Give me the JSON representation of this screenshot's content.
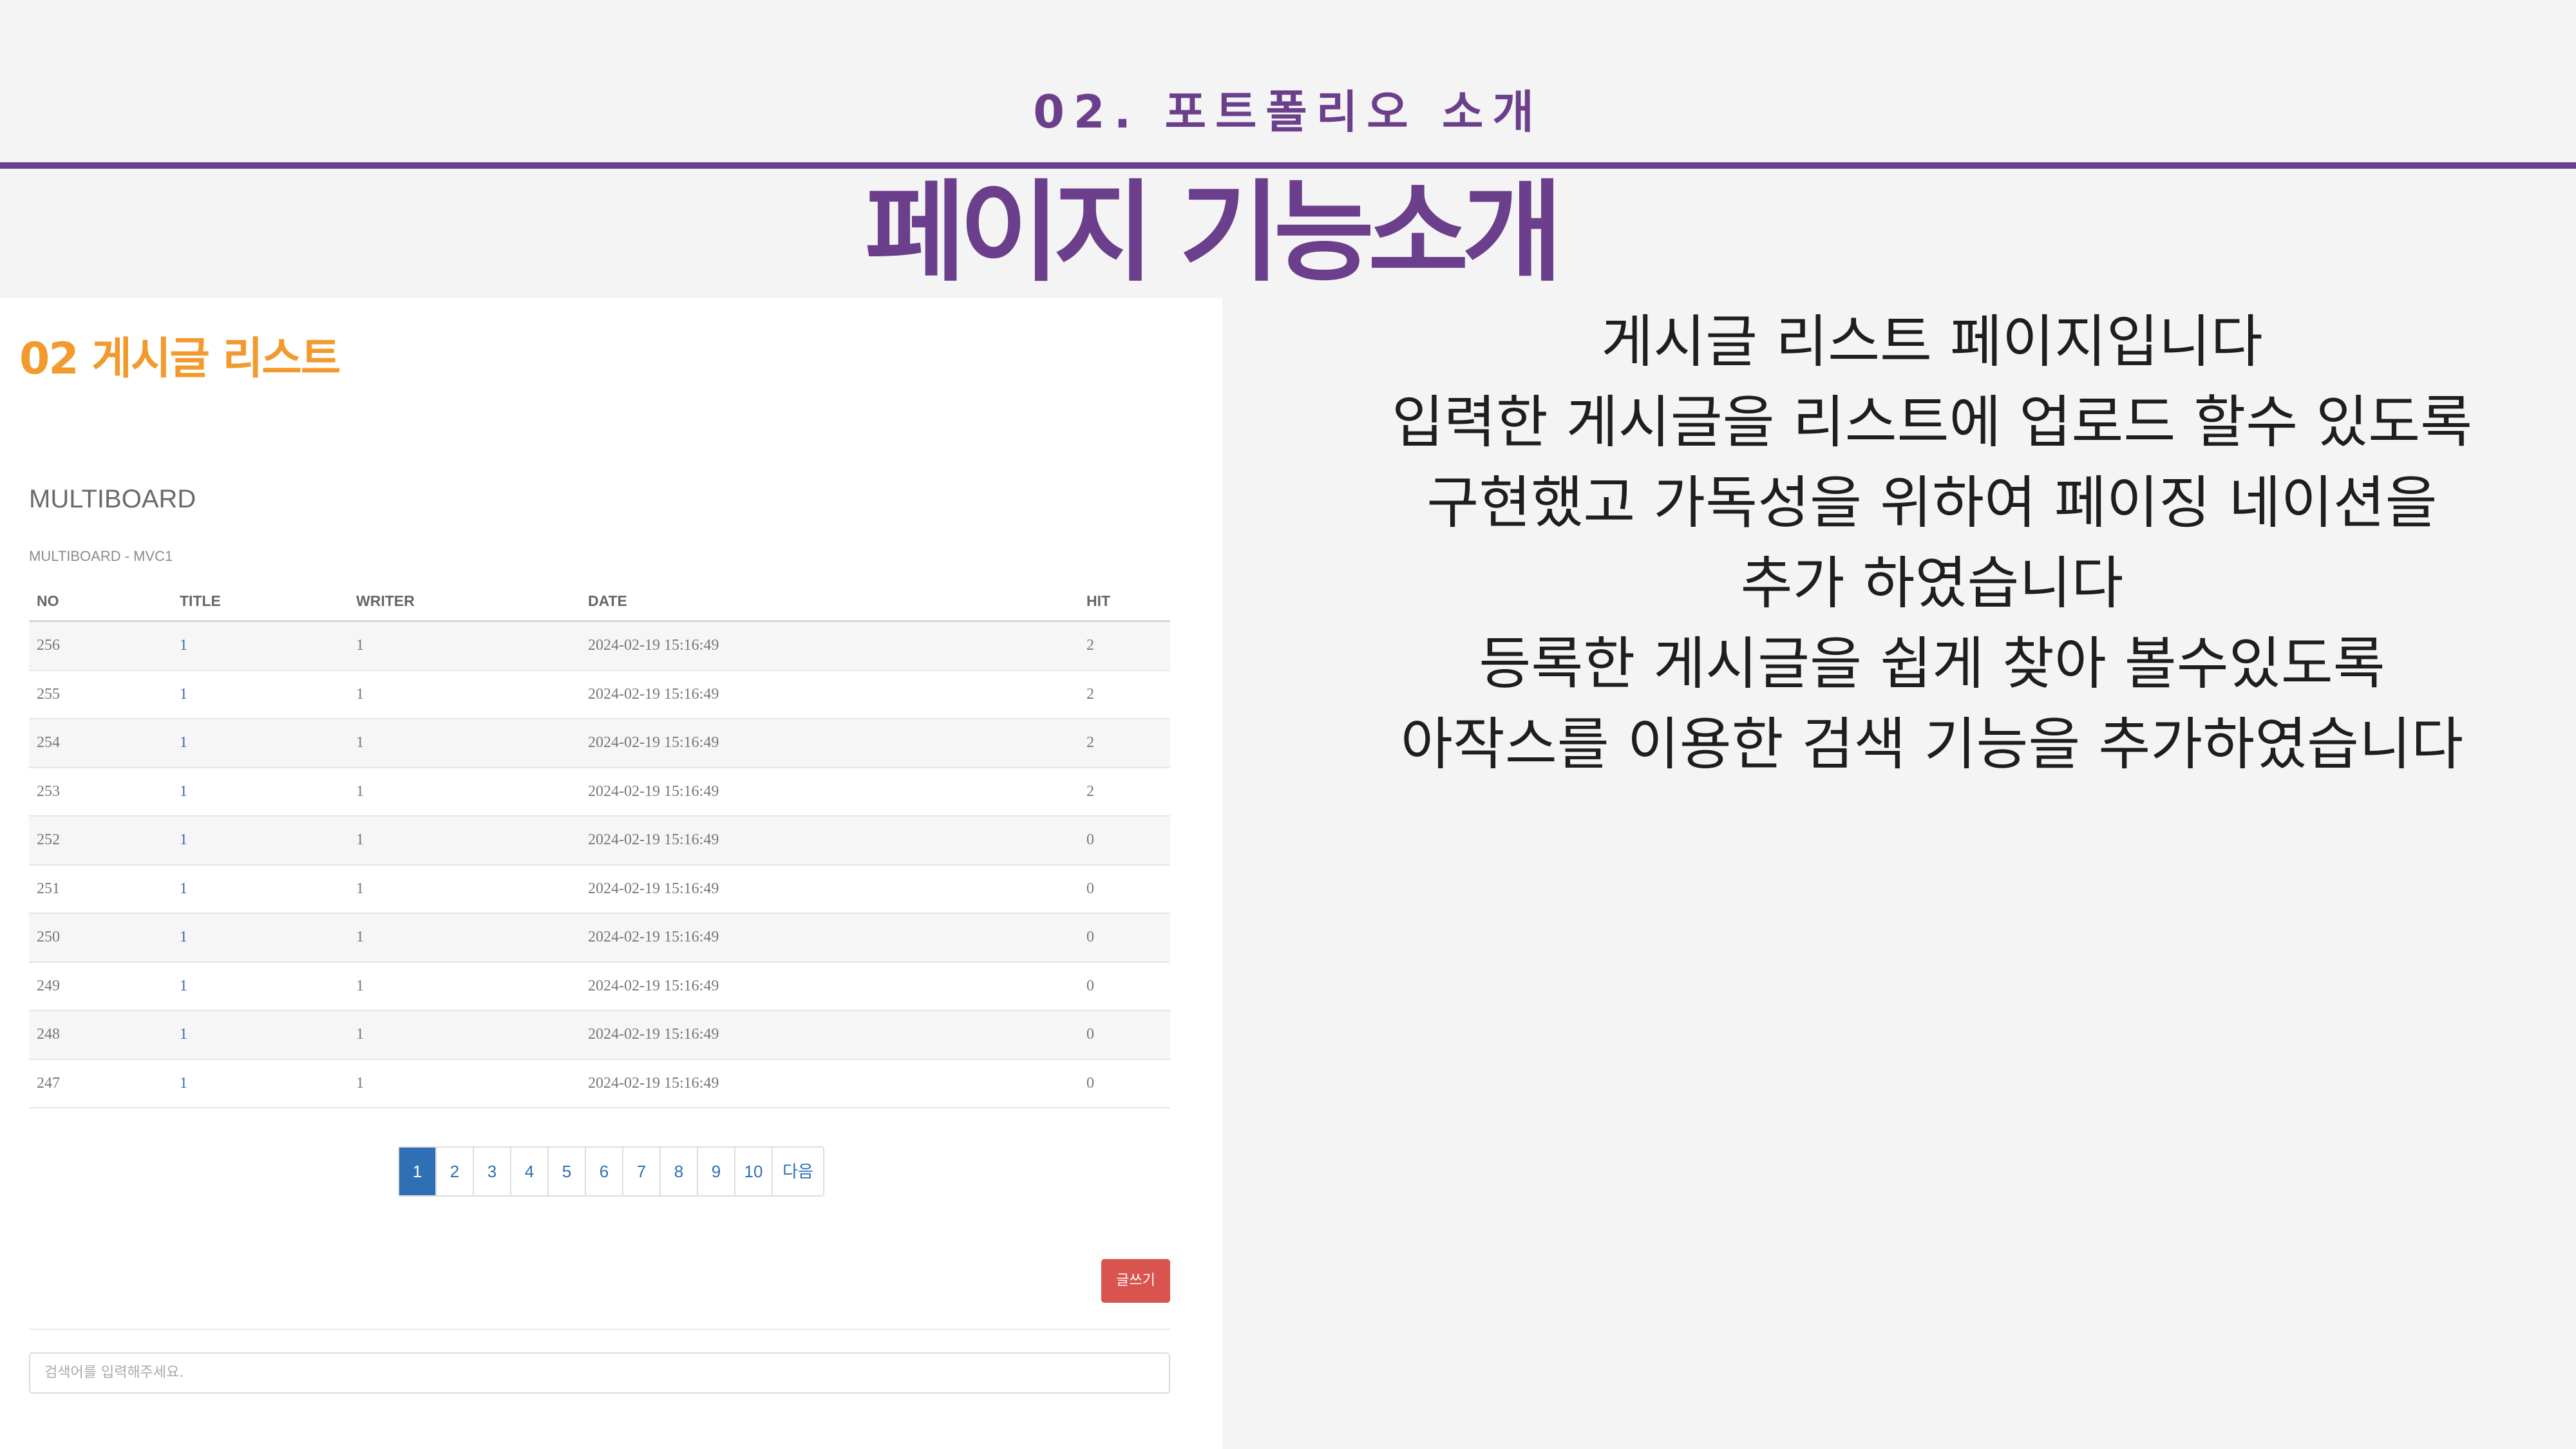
{
  "header": {
    "section_label": "02. 포트폴리오 소개",
    "page_title": "페이지 기능소개"
  },
  "screenshot": {
    "heading": "02  게시글 리스트",
    "board_title": "MULTIBOARD",
    "board_subtitle": "MULTIBOARD - MVC1",
    "columns": [
      "NO",
      "TITLE",
      "WRITER",
      "DATE",
      "HIT"
    ],
    "rows": [
      [
        "256",
        "1",
        "1",
        "2024-02-19 15:16:49",
        "2"
      ],
      [
        "255",
        "1",
        "1",
        "2024-02-19 15:16:49",
        "2"
      ],
      [
        "254",
        "1",
        "1",
        "2024-02-19 15:16:49",
        "2"
      ],
      [
        "253",
        "1",
        "1",
        "2024-02-19 15:16:49",
        "2"
      ],
      [
        "252",
        "1",
        "1",
        "2024-02-19 15:16:49",
        "0"
      ],
      [
        "251",
        "1",
        "1",
        "2024-02-19 15:16:49",
        "0"
      ],
      [
        "250",
        "1",
        "1",
        "2024-02-19 15:16:49",
        "0"
      ],
      [
        "249",
        "1",
        "1",
        "2024-02-19 15:16:49",
        "0"
      ],
      [
        "248",
        "1",
        "1",
        "2024-02-19 15:16:49",
        "0"
      ],
      [
        "247",
        "1",
        "1",
        "2024-02-19 15:16:49",
        "0"
      ]
    ],
    "pagination": [
      "1",
      "2",
      "3",
      "4",
      "5",
      "6",
      "7",
      "8",
      "9",
      "10",
      "다음"
    ],
    "active_page": "1",
    "write_button": "글쓰기",
    "search_placeholder": "검색어를 입력해주세요."
  },
  "description": [
    "게시글  리스트 페이지입니다",
    "입력한 게시글을 리스트에 업로드 할수 있도록",
    "구현했고 가독성을 위하여 페이징 네이션을",
    "추가 하였습니다",
    "등록한 게시글을 쉽게 찾아 볼수있도록",
    "아작스를 이용한 검색 기능을 추가하였습니다"
  ],
  "colors": {
    "accent_purple": "#6b3f8c",
    "heading_orange": "#f39a2e",
    "link_blue": "#2f6fb3",
    "button_red": "#d9534f"
  }
}
